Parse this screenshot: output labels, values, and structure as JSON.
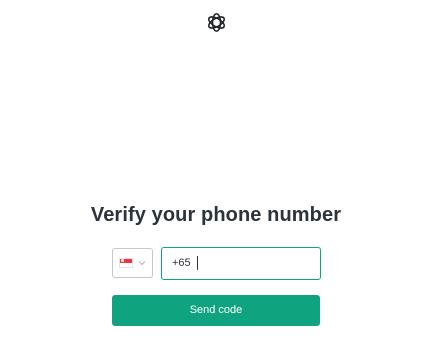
{
  "brand": {
    "logo_icon": "openai-logo-icon",
    "logo_color": "#202123"
  },
  "heading": {
    "title": "Verify your phone number"
  },
  "phone_form": {
    "country": {
      "flag_icon": "singapore-flag-icon",
      "chevron_icon": "chevron-down-icon"
    },
    "phone_input": {
      "value": "+65",
      "focused": true
    },
    "send_button_label": "Send code"
  },
  "colors": {
    "accent": "#10a37f",
    "text": "#2d333a",
    "border": "#c2c8d0",
    "background": "#ffffff"
  }
}
